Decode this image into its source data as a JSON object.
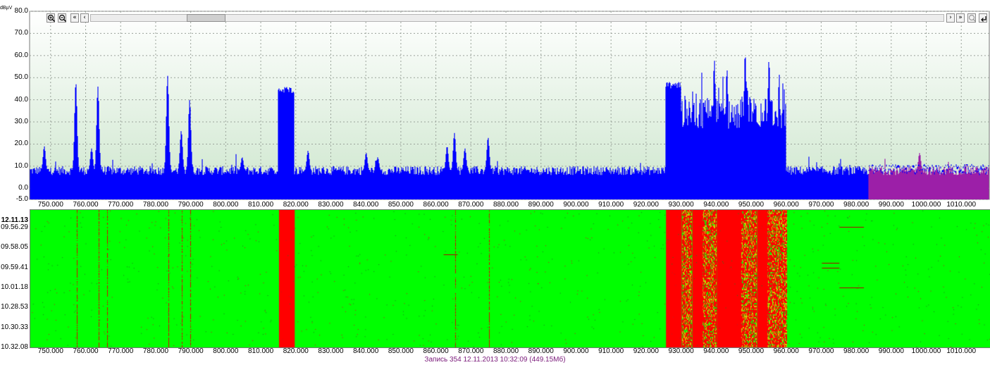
{
  "colors": {
    "spectrum_bg_top": "#ffffff",
    "spectrum_bg_bottom": "#cfe7cf",
    "spectrum_line": "#0000ff",
    "spectrum_tail": "#9c1fa8",
    "waterfall_low": "#00ff00",
    "waterfall_high": "#ff0000",
    "grid": "#9aa39a",
    "status_text": "#7a1a7a"
  },
  "toolbar": {
    "zoom_in": "zoom-in-icon",
    "zoom_out": "zoom-out-icon",
    "first": "«",
    "prev": "‹",
    "next": "›",
    "last": "»"
  },
  "waterfall": {
    "date": "12.11.13",
    "times": [
      "09.56.29",
      "09.58.05",
      "09.59.41",
      "10.01.18",
      "10.28.53",
      "10.30.33",
      "10.32.08"
    ]
  },
  "status_bar": {
    "text": "Запись 354 12.11.2013 10:32:09 (449.15Мб)"
  },
  "chart_data": {
    "type": "area",
    "title": "",
    "xlabel": "",
    "ylabel": "",
    "y_unit_label": "dBµV",
    "xlim": [
      744,
      1018
    ],
    "ylim": [
      -5,
      80
    ],
    "grid": true,
    "x_ticks": [
      "750.000",
      "760.000",
      "770.000",
      "780.000",
      "790.000",
      "800.000",
      "810.000",
      "820.000",
      "830.000",
      "840.000",
      "850.000",
      "860.000",
      "870.000",
      "880.000",
      "890.000",
      "900.000",
      "910.000",
      "920.000",
      "930.000",
      "940.000",
      "950.000",
      "960.000",
      "970.000",
      "980.000",
      "990.000",
      "1000.000",
      "1010.000"
    ],
    "y_ticks": [
      "80.0",
      "70.0",
      "60.0",
      "50.0",
      "40.0",
      "30.0",
      "20.0",
      "10.0",
      "0.0",
      "-5.0"
    ],
    "baseline_level": 8,
    "noise_amplitude": 4,
    "peaks": [
      {
        "x": 748.2,
        "y": 19
      },
      {
        "x": 757.2,
        "y": 48
      },
      {
        "x": 761.7,
        "y": 18
      },
      {
        "x": 763.5,
        "y": 46
      },
      {
        "x": 783.4,
        "y": 51
      },
      {
        "x": 787.3,
        "y": 26
      },
      {
        "x": 789.7,
        "y": 40
      },
      {
        "x": 804.7,
        "y": 14
      },
      {
        "x": 823.5,
        "y": 17
      },
      {
        "x": 840.1,
        "y": 16
      },
      {
        "x": 843.4,
        "y": 14
      },
      {
        "x": 863.2,
        "y": 19
      },
      {
        "x": 865.3,
        "y": 25
      },
      {
        "x": 868.3,
        "y": 18
      },
      {
        "x": 874.9,
        "y": 23
      },
      {
        "x": 939.5,
        "y": 58
      },
      {
        "x": 943.1,
        "y": 54
      },
      {
        "x": 948.3,
        "y": 61
      },
      {
        "x": 955.1,
        "y": 58
      },
      {
        "x": 998.1,
        "y": 16
      }
    ],
    "bands": [
      {
        "from": 815.0,
        "to": 819.5,
        "level": 44
      },
      {
        "from": 925.5,
        "to": 930.0,
        "level": 46
      },
      {
        "from": 930.0,
        "to": 960.0,
        "level": 31
      }
    ],
    "tail_region": {
      "from": 983.5,
      "to": 1018.0,
      "level": 9
    },
    "waterfall_hot_bands": [
      {
        "from": 815.0,
        "to": 819.5
      },
      {
        "from": 925.5,
        "to": 930.0
      },
      {
        "from": 933.0,
        "to": 936.0
      },
      {
        "from": 940.0,
        "to": 947.0
      },
      {
        "from": 951.5,
        "to": 954.5
      }
    ],
    "waterfall_noisy_bands": [
      {
        "from": 930.0,
        "to": 933.0
      },
      {
        "from": 936.0,
        "to": 940.0
      },
      {
        "from": 947.0,
        "to": 951.5
      },
      {
        "from": 954.5,
        "to": 960.0
      }
    ],
    "waterfall_lines": [
      757.2,
      763.5,
      766.0,
      783.4,
      787.3,
      789.7,
      865.3,
      874.9
    ]
  }
}
